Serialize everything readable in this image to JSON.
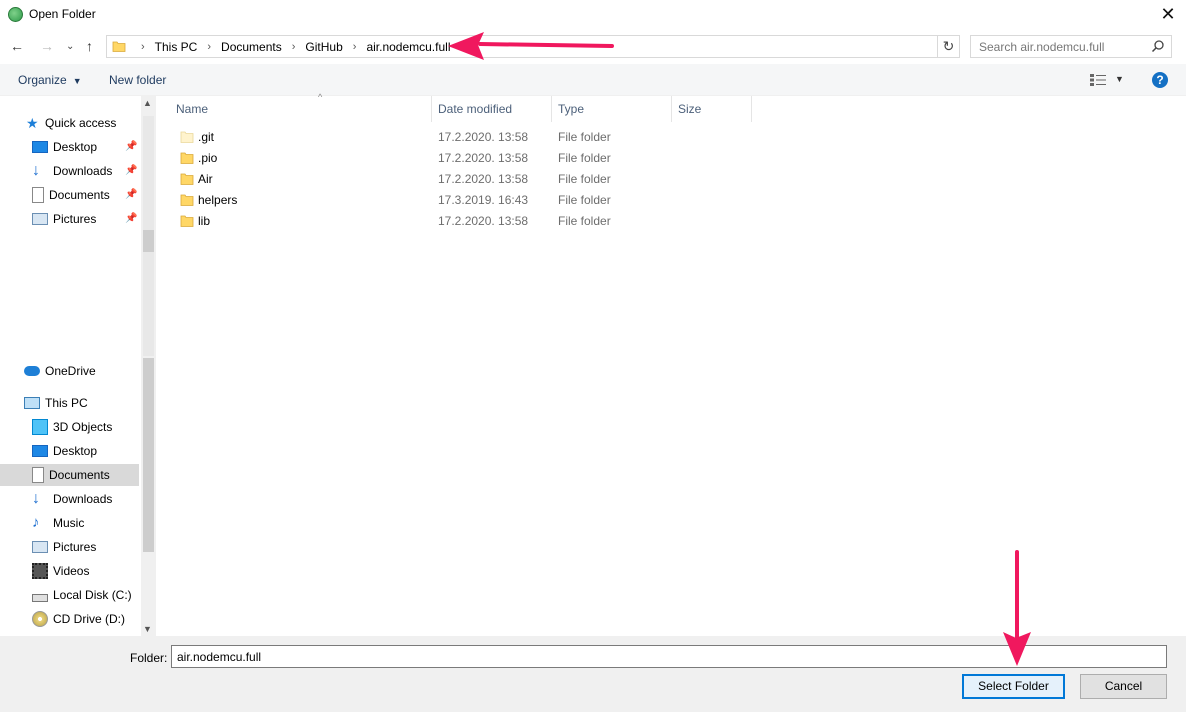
{
  "window": {
    "title": "Open Folder"
  },
  "address": {
    "crumbs": [
      "This PC",
      "Documents",
      "GitHub",
      "air.nodemcu.full"
    ]
  },
  "search": {
    "placeholder": "Search air.nodemcu.full"
  },
  "toolbar": {
    "organize_label": "Organize",
    "new_folder_label": "New folder"
  },
  "navigation": {
    "quick_access": "Quick access",
    "quick_items": [
      "Desktop",
      "Downloads",
      "Documents",
      "Pictures"
    ],
    "onedrive": "OneDrive",
    "this_pc": "This PC",
    "pc_items": [
      "3D Objects",
      "Desktop",
      "Documents",
      "Downloads",
      "Music",
      "Pictures",
      "Videos",
      "Local Disk (C:)",
      "CD Drive (D:)"
    ],
    "selected": "Documents"
  },
  "columns": {
    "name": "Name",
    "date": "Date modified",
    "type": "Type",
    "size": "Size"
  },
  "files": [
    {
      "name": ".git",
      "date": "17.2.2020. 13:58",
      "type": "File folder"
    },
    {
      "name": ".pio",
      "date": "17.2.2020. 13:58",
      "type": "File folder"
    },
    {
      "name": "Air",
      "date": "17.2.2020. 13:58",
      "type": "File folder"
    },
    {
      "name": "helpers",
      "date": "17.3.2019. 16:43",
      "type": "File folder"
    },
    {
      "name": "lib",
      "date": "17.2.2020. 13:58",
      "type": "File folder"
    }
  ],
  "footer": {
    "folder_label": "Folder:",
    "folder_value": "air.nodemcu.full",
    "select_label": "Select Folder",
    "cancel_label": "Cancel"
  },
  "colors": {
    "annotation_arrow": "#f0185e",
    "accent": "#0078d7"
  }
}
